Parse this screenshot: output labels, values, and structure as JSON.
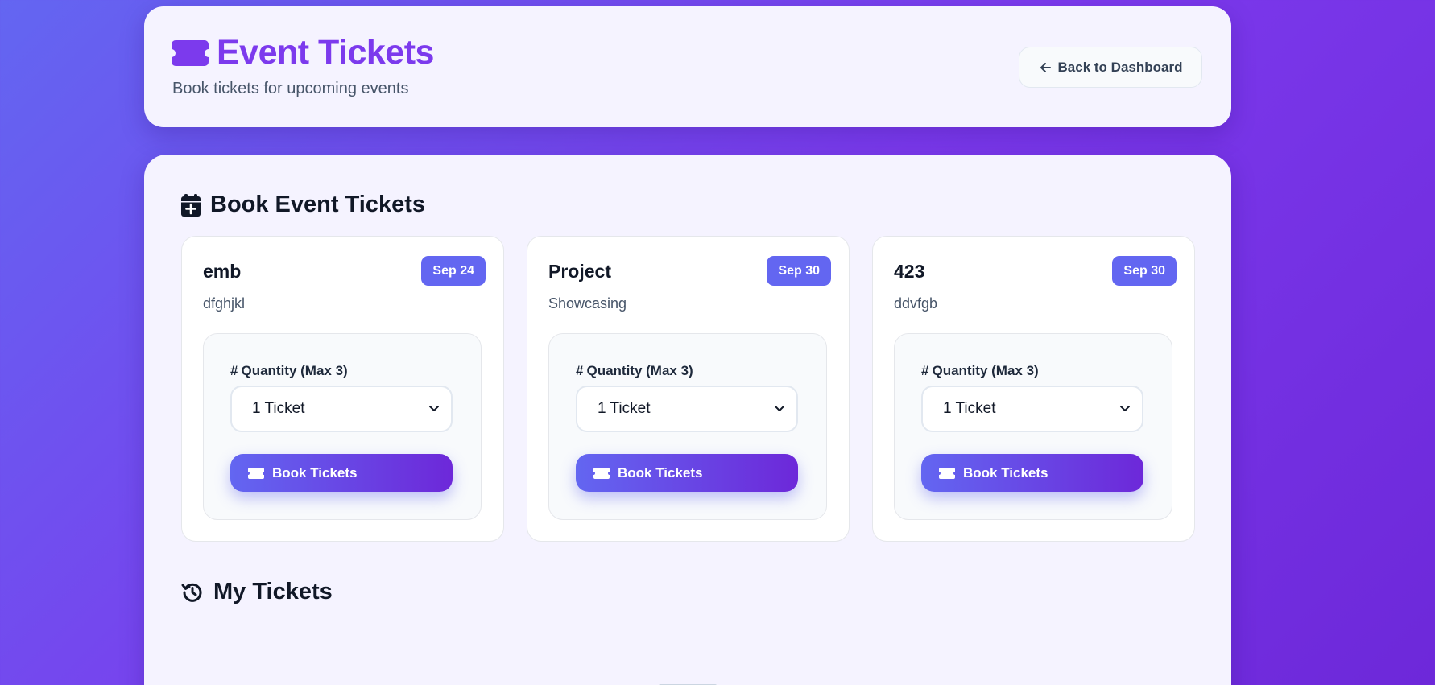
{
  "header": {
    "title": "Event Tickets",
    "subtitle": "Book tickets for upcoming events",
    "back_label": "Back to Dashboard"
  },
  "booking": {
    "section_title": "Book Event Tickets",
    "quantity_label": "Quantity (Max 3)",
    "book_label": "Book Tickets",
    "events": [
      {
        "name": "emb",
        "date": "Sep 24",
        "description": "dfghjkl",
        "quantity": "1 Ticket"
      },
      {
        "name": "Project",
        "date": "Sep 30",
        "description": "Showcasing",
        "quantity": "1 Ticket"
      },
      {
        "name": "423",
        "date": "Sep 30",
        "description": "ddvfgb",
        "quantity": "1 Ticket"
      }
    ]
  },
  "my_tickets": {
    "section_title": "My Tickets"
  },
  "colors": {
    "accent": "#7c3aed",
    "badge": "#6366f1",
    "background_start": "#6366f1",
    "background_end": "#6d28d9"
  }
}
